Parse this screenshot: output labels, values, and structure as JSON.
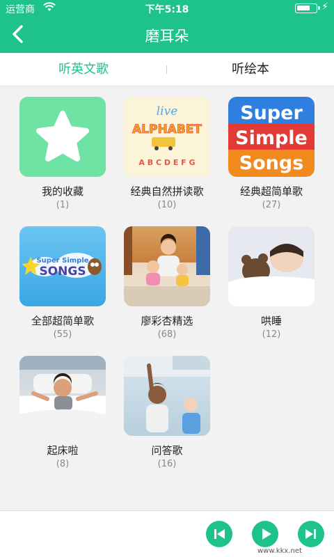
{
  "status_bar": {
    "carrier": "运营商",
    "time": "下午5:18"
  },
  "header": {
    "title": "磨耳朵"
  },
  "tabs": [
    {
      "label": "听英文歌",
      "active": true
    },
    {
      "label": "听绘本",
      "active": false
    }
  ],
  "playlists": [
    {
      "name": "我的收藏",
      "count": "(1)"
    },
    {
      "name": "经典自然拼读歌",
      "count": "(10)"
    },
    {
      "name": "经典超简单歌",
      "count": "(27)"
    },
    {
      "name": "全部超简单歌",
      "count": "(55)"
    },
    {
      "name": "廖彩杏精选",
      "count": "(68)"
    },
    {
      "name": "哄睡",
      "count": "(12)"
    },
    {
      "name": "起床啦",
      "count": "(8)"
    },
    {
      "name": "问答歌",
      "count": "(16)"
    }
  ],
  "cover_text": {
    "live_alphabet": [
      "live",
      "ALPHABET",
      "A B C D E F G"
    ],
    "super_simple_songs": [
      "Super",
      "Simple",
      "Songs"
    ],
    "sss_logo": [
      "Super Simple",
      "SONGS"
    ]
  },
  "player": {
    "controls": [
      "previous-icon",
      "play-icon",
      "next-icon"
    ]
  },
  "watermark": "www.kkx.net",
  "colors": {
    "accent": "#1ec28b",
    "background": "#f2f2f2"
  }
}
